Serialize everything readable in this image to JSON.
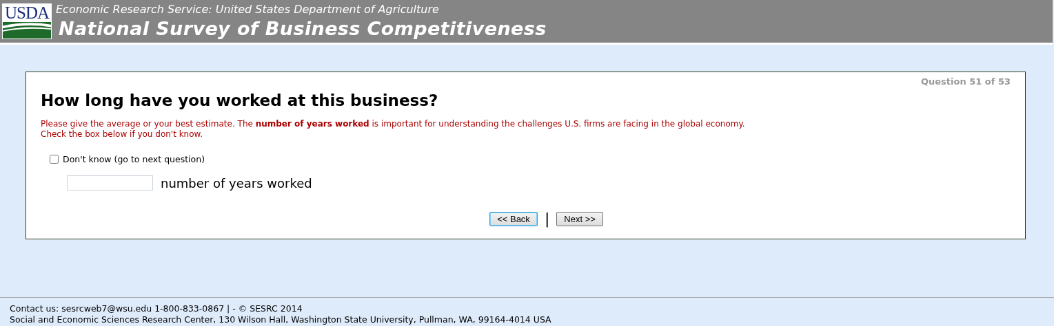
{
  "header": {
    "logo": "USDA",
    "agency": "Economic Research Service: United States Department of Agriculture",
    "title": "National Survey of Business Competitiveness"
  },
  "question": {
    "progress": "Question 51 of 53",
    "title": "How long have you worked at this business?",
    "instructions": "Please give the average or your best estimate. The **number of years worked** is important for understanding the challenges U.S. firms are facing in the global economy.",
    "note": "Check the box below if you don't know.",
    "dont_know": {
      "label": "Don't know (go to next question)",
      "checked": false
    },
    "answer": {
      "unit": "number of years worked"
    }
  },
  "nav": {
    "buttons": [
      {
        "label": "<< Back",
        "focused": true
      },
      {
        "label": "Next >>",
        "focused": false
      }
    ],
    "separator": "|"
  },
  "footer": {
    "contact": "Contact us: sesrcweb7@wsu.edu 1-800-833-0867 | - © SESRC 2014",
    "address": "Social and Economic Sciences Research Center, 130 Wilson Hall, Washington State University, Pullman, WA, 99164-4014 USA"
  }
}
